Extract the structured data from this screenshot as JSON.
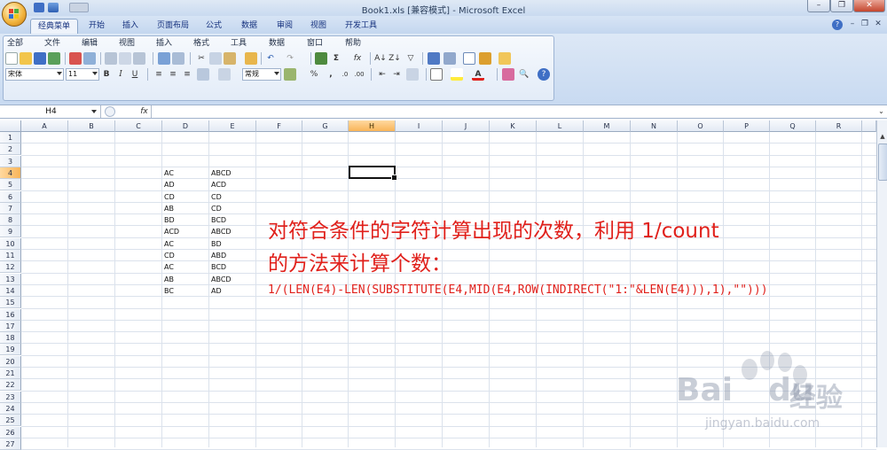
{
  "window": {
    "title": "Book1.xls  [兼容模式] - Microsoft Excel",
    "buttons": {
      "minimize": "–",
      "restore": "❐",
      "close": "✕"
    }
  },
  "tabs": [
    "经典菜单",
    "开始",
    "插入",
    "页面布局",
    "公式",
    "数据",
    "审阅",
    "视图",
    "开发工具"
  ],
  "menu": [
    "全部",
    "文件",
    "编辑",
    "视图",
    "插入",
    "格式",
    "工具",
    "数据",
    "窗口",
    "帮助"
  ],
  "format_bar": {
    "font": "宋体",
    "size": "11",
    "bold": "B",
    "italic": "I",
    "underline": "U",
    "number_format": "常规",
    "percent": "%",
    "comma": ","
  },
  "name_box": "H4",
  "fx_label": "fx",
  "columns": [
    "A",
    "B",
    "C",
    "D",
    "E",
    "F",
    "G",
    "H",
    "I",
    "J",
    "K",
    "L",
    "M",
    "N",
    "O",
    "P",
    "Q",
    "R"
  ],
  "selected_column": "H",
  "rows": [
    "1",
    "2",
    "3",
    "4",
    "5",
    "6",
    "7",
    "8",
    "9",
    "10",
    "11",
    "12",
    "13",
    "14",
    "15",
    "16",
    "17",
    "18",
    "19",
    "20",
    "21",
    "22",
    "23",
    "24",
    "25",
    "26",
    "27"
  ],
  "selected_row": "4",
  "cells": {
    "D": [
      "AC",
      "AD",
      "CD",
      "AB",
      "BD",
      "ACD",
      "AC",
      "CD",
      "AC",
      "AB",
      "BC"
    ],
    "E": [
      "ABCD",
      "ACD",
      "CD",
      "CD",
      "BCD",
      "ABCD",
      "BD",
      "ABD",
      "BCD",
      "ABCD",
      "AD"
    ]
  },
  "annotation": {
    "line1": "对符合条件的字符计算出现的次数，利用 1/count",
    "line2": "的方法来计算个数：",
    "formula": "1/(LEN(E4)-LEN(SUBSTITUTE(E4,MID(E4,ROW(INDIRECT(\"1:\"&LEN(E4))),1),\"\")))",
    "color": "#e0201b"
  },
  "watermark": {
    "brand": "Bai",
    "brand2": "du",
    "cn": "经验",
    "url": "jingyan.baidu.com"
  }
}
